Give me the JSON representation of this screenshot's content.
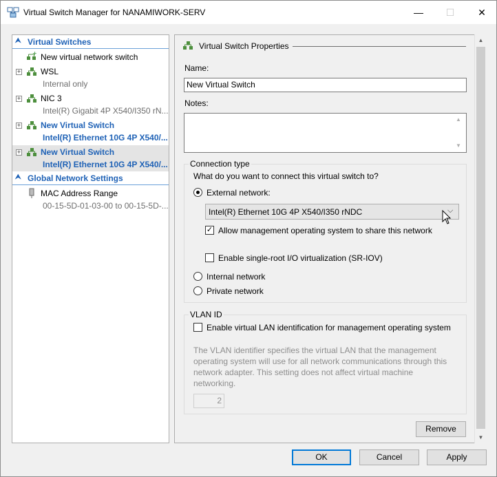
{
  "window": {
    "title": "Virtual Switch Manager for NANAMIWORK-SERV",
    "controls": {
      "minimize": "—",
      "maximize": "☐",
      "close": "✕"
    }
  },
  "sidebar": {
    "virtual_switches_header": "Virtual Switches",
    "global_header": "Global Network Settings",
    "items": [
      {
        "title": "New virtual network switch",
        "subtitle": ""
      },
      {
        "title": "WSL",
        "subtitle": "Internal only"
      },
      {
        "title": "NIC 3",
        "subtitle": "Intel(R) Gigabit 4P X540/I350 rN..."
      },
      {
        "title": "New Virtual Switch",
        "subtitle": "Intel(R) Ethernet 10G 4P X540/..."
      },
      {
        "title": "New Virtual Switch",
        "subtitle": "Intel(R) Ethernet 10G 4P X540/..."
      }
    ],
    "mac": {
      "title": "MAC Address Range",
      "subtitle": "00-15-5D-01-03-00 to 00-15-5D-..."
    }
  },
  "properties": {
    "header": "Virtual Switch Properties",
    "name_label": "Name:",
    "name_value": "New Virtual Switch",
    "notes_label": "Notes:",
    "notes_value": "",
    "connection_type": {
      "title": "Connection type",
      "question": "What do you want to connect this virtual switch to?",
      "external_label": "External network:",
      "adapter_selected": "Intel(R) Ethernet 10G 4P X540/I350 rNDC",
      "allow_mgmt_label": "Allow management operating system to share this network",
      "allow_mgmt_checked": true,
      "sriov_label": "Enable single-root I/O virtualization (SR-IOV)",
      "sriov_checked": false,
      "internal_label": "Internal network",
      "private_label": "Private network",
      "selected": "external"
    },
    "vlan": {
      "title": "VLAN ID",
      "enable_label": "Enable virtual LAN identification for management operating system",
      "enable_checked": false,
      "description": [
        "The VLAN identifier specifies the virtual LAN that the management",
        "operating system will use for all network communications through this",
        "network adapter. This setting does not affect virtual machine",
        "networking."
      ],
      "id_value": "2"
    },
    "remove_button": "Remove"
  },
  "footer": {
    "ok": "OK",
    "cancel": "Cancel",
    "apply": "Apply"
  },
  "colors": {
    "accent": "#1f62b6",
    "selection": "#e4e4e4",
    "default_button_border": "#0078d7"
  }
}
